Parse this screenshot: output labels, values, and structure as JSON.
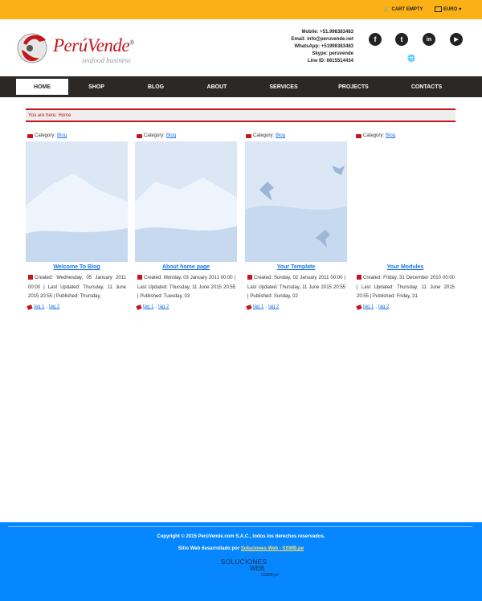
{
  "topbar": {
    "cart_label": "CART EMPTY",
    "currency_label": "EURO"
  },
  "brand": {
    "name": "PerúVende",
    "registered": "®",
    "tagline": "seafood business"
  },
  "contact": {
    "mobile": "Mobile: +51.998383483",
    "email": "Email: info@peruvende.net",
    "whatsapp": "WhatsApp: +51998383483",
    "skype": "Skype: peruvende",
    "line": "Line ID: 6615514434"
  },
  "social": {
    "facebook": "f",
    "tumblr": "t",
    "linkedin": "in",
    "youtube": "▶"
  },
  "nav": {
    "items": [
      "HOME",
      "SHOP",
      "BLOG",
      "ABOUT",
      "SERVICES",
      "PROJECTS",
      "CONTACTS"
    ],
    "active": "HOME"
  },
  "breadcrumb": {
    "text": "You are here: Home"
  },
  "posts": [
    {
      "category_label": "Category:",
      "category": "Blog",
      "title": "Welcome To Blog",
      "meta": "Created: Wednesday, 05 January 2011 00:00 | Last Updated: Thursday, 11 June 2015 20:55 | Published: Thursday,",
      "tag1": "tag 1",
      "tag2": "tag 2"
    },
    {
      "category_label": "Category:",
      "category": "Blog",
      "title": "About home page",
      "meta": "Created: Monday, 03 January 2011 00:00 | Last Updated: Thursday, 11 June 2015 20:55 | Published: Tuesday, 03",
      "tag1": "tag 1",
      "tag2": "tag 2"
    },
    {
      "category_label": "Category:",
      "category": "Blog",
      "title": "Your Template",
      "meta": "Created: Sunday, 02 January 2011 00:00 | Last Updated: Thursday, 11 June 2015 20:55 | Published: Sunday, 02",
      "tag1": "tag 1",
      "tag2": "tag 2"
    },
    {
      "category_label": "Category:",
      "category": "Blog",
      "title": "Your Modules",
      "meta": "Created: Friday, 31 December 2010 00:00 | Last Updated: Thursday, 11 June 2015 20:55 | Published: Friday, 31",
      "tag1": "tag 1",
      "tag2": "tag 2"
    }
  ],
  "footer": {
    "copyright": "Copyright © 2015 PerúVende.com S.A.C., todos los derechos reservados.",
    "developed_prefix": "Sitio Web desarrollado por",
    "developer_link": "Soluciones Web - SSWB.pe",
    "logo_line1": "SOLUCIONES",
    "logo_line2": "WEB",
    "logo_line3": "SSWB.pe"
  },
  "colors": {
    "topbar": "#fbb116",
    "nav": "#2b2825",
    "accent": "#c4161c",
    "link": "#1a73e8",
    "footer": "#0686ff"
  }
}
